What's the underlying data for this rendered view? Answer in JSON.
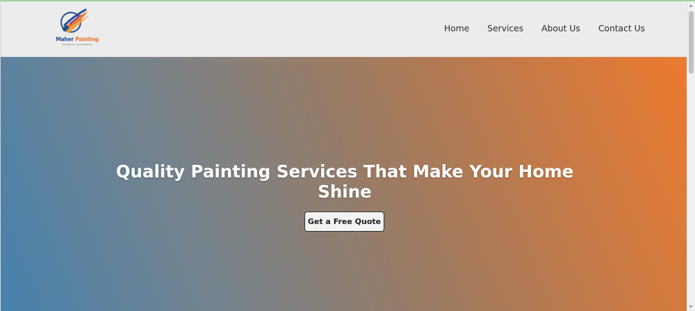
{
  "logo": {
    "name_part1": "Maher",
    "name_part2": "Painting",
    "tagline": "Coloring Your Colorful World!",
    "icon": "paint-brush-logo-icon"
  },
  "nav": {
    "items": [
      {
        "label": "Home"
      },
      {
        "label": "Services"
      },
      {
        "label": "About Us"
      },
      {
        "label": "Contact Us"
      }
    ]
  },
  "hero": {
    "title": "Quality Painting Services That Make Your Home Shine",
    "cta_label": "Get a Free Quote"
  },
  "colors": {
    "brand_blue": "#1f4e8c",
    "brand_orange": "#e8772e",
    "hero_gradient_start": "#4681ae",
    "hero_gradient_end": "#ec7a2e",
    "navbar_bg": "#ececec"
  },
  "scrollbar": {
    "position_fraction": 0.0
  }
}
